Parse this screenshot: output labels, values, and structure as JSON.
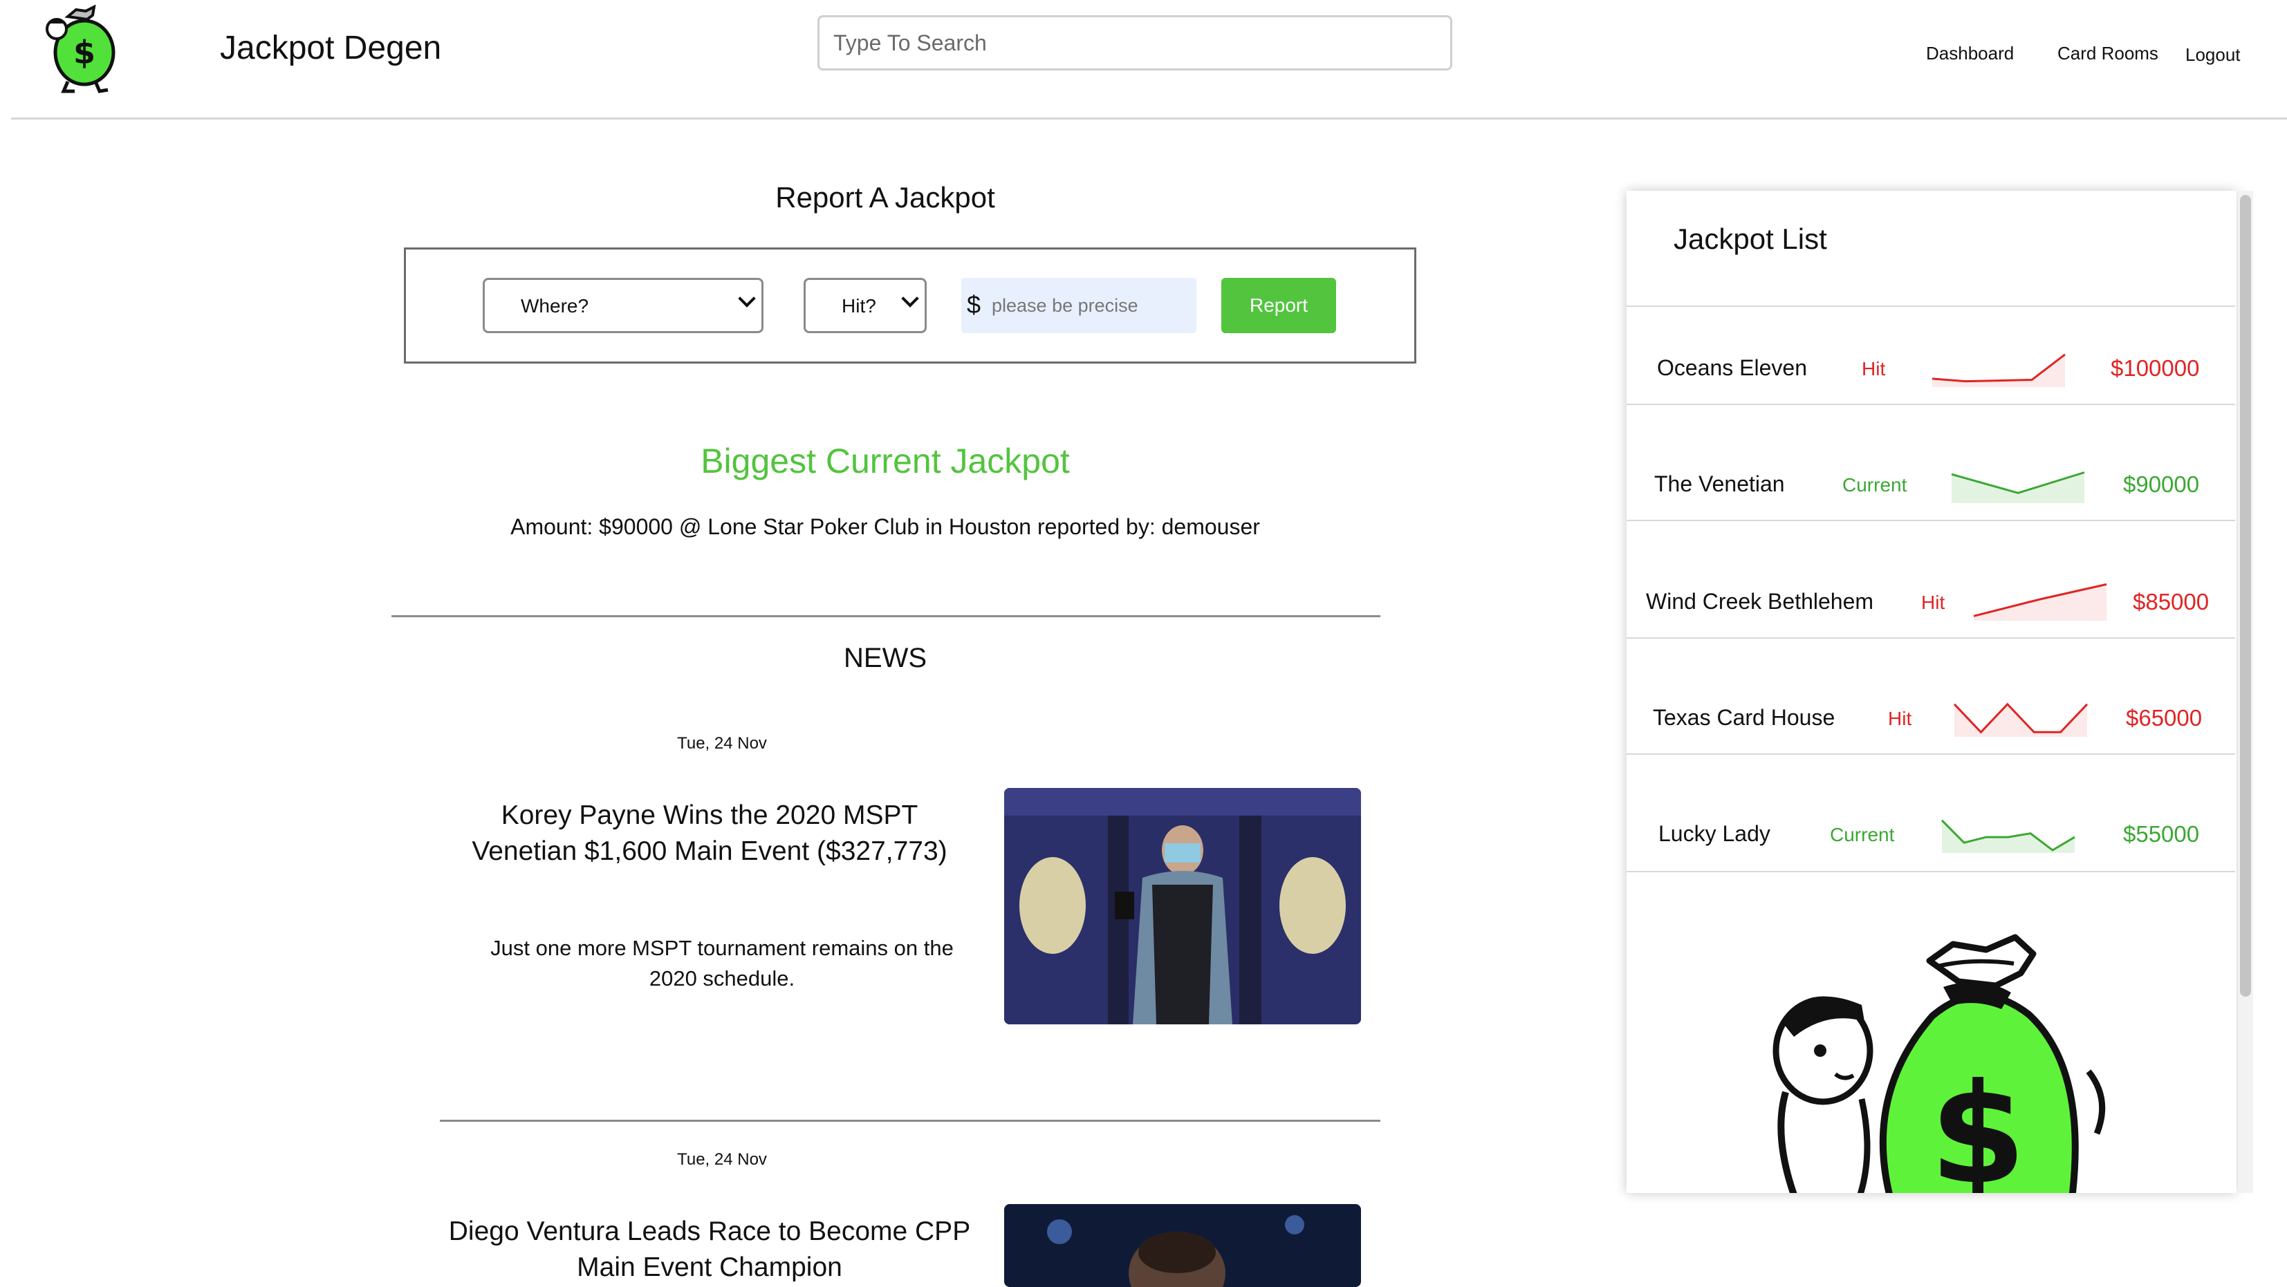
{
  "header": {
    "brand": "Jackpot Degen",
    "search_placeholder": "Type To Search",
    "nav": {
      "dashboard": "Dashboard",
      "card_rooms": "Card Rooms",
      "logout": "Logout"
    }
  },
  "report": {
    "title": "Report A Jackpot",
    "where_select": "Where?",
    "hit_select": "Hit?",
    "currency_symbol": "$",
    "amount_placeholder": "please be precise",
    "submit_label": "Report"
  },
  "biggest": {
    "title": "Biggest Current Jackpot",
    "text": "Amount: $90000 @ Lone Star Poker Club in Houston reported by: demouser"
  },
  "news": {
    "title": "NEWS",
    "items": [
      {
        "date": "Tue, 24 Nov",
        "headline": "Korey Payne Wins the 2020 MSPT Venetian $1,600 Main Event ($327,773)",
        "summary": "Just one more MSPT tournament remains on the 2020 schedule."
      },
      {
        "date": "Tue, 24 Nov",
        "headline": "Diego Ventura Leads Race to Become CPP Main Event Champion"
      }
    ]
  },
  "jackpot_list": {
    "title": "Jackpot List",
    "colors": {
      "hit": "#e02424",
      "current": "#3aa832"
    },
    "rows": [
      {
        "name": "Oceans Eleven",
        "status": "Hit",
        "amount": "$100000",
        "trend": [
          15,
          8,
          10,
          12,
          80
        ]
      },
      {
        "name": "The Venetian",
        "status": "Current",
        "amount": "$90000",
        "trend": [
          70,
          20,
          75
        ]
      },
      {
        "name": "Wind Creek Bethlehem",
        "status": "Hit",
        "amount": "$85000",
        "trend": [
          5,
          50,
          90
        ]
      },
      {
        "name": "Texas Card House",
        "status": "Hit",
        "amount": "$65000",
        "trend": [
          80,
          5,
          80,
          5,
          5,
          80
        ]
      },
      {
        "name": "Lucky Lady",
        "status": "Current",
        "amount": "$55000",
        "trend": [
          80,
          20,
          35,
          35,
          45,
          0,
          35
        ]
      }
    ]
  }
}
